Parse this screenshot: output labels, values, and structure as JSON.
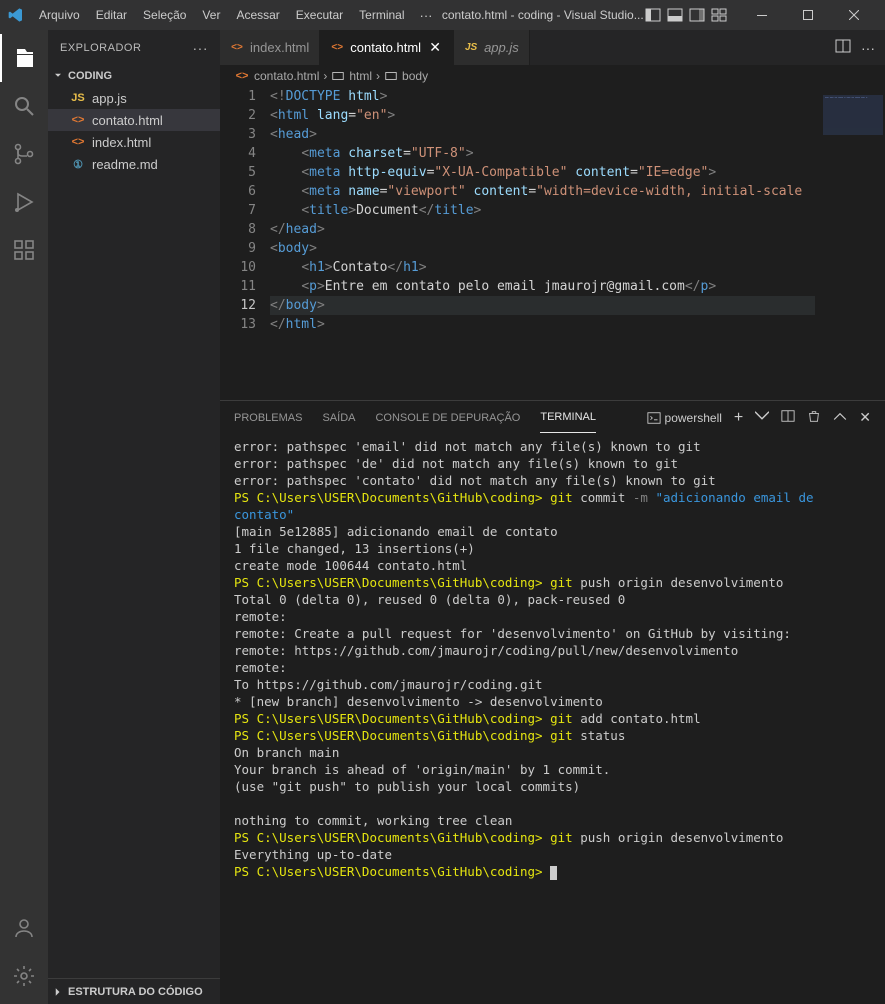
{
  "titlebar": {
    "menus": [
      "Arquivo",
      "Editar",
      "Seleção",
      "Ver",
      "Acessar",
      "Executar",
      "Terminal"
    ],
    "ellipsis": "···",
    "title": "contato.html - coding - Visual Studio..."
  },
  "sidebar": {
    "header": "EXPLORADOR",
    "folder": "CODING",
    "files": [
      {
        "name": "app.js",
        "type": "js"
      },
      {
        "name": "contato.html",
        "type": "html",
        "active": true
      },
      {
        "name": "index.html",
        "type": "html"
      },
      {
        "name": "readme.md",
        "type": "md"
      }
    ],
    "footer": "ESTRUTURA DO CÓDIGO"
  },
  "tabs": [
    {
      "name": "index.html",
      "type": "html",
      "active": false,
      "modified": false
    },
    {
      "name": "contato.html",
      "type": "html",
      "active": true,
      "modified": false,
      "close": true
    },
    {
      "name": "app.js",
      "type": "js",
      "active": false,
      "modified": true
    }
  ],
  "breadcrumb": {
    "file": "contato.html",
    "el1": "html",
    "el2": "body"
  },
  "code": {
    "lines": [
      {
        "n": 1,
        "html": "<span class='tk-bracket'>&lt;!</span><span class='tk-doct'>DOCTYPE </span><span class='tk-attr'>html</span><span class='tk-bracket'>&gt;</span>"
      },
      {
        "n": 2,
        "html": "<span class='tk-bracket'>&lt;</span><span class='tk-tag'>html</span> <span class='tk-attr'>lang</span><span class='tk-text'>=</span><span class='tk-val'>\"en\"</span><span class='tk-bracket'>&gt;</span>"
      },
      {
        "n": 3,
        "html": "<span class='tk-bracket'>&lt;</span><span class='tk-tag'>head</span><span class='tk-bracket'>&gt;</span>"
      },
      {
        "n": 4,
        "html": "    <span class='tk-bracket'>&lt;</span><span class='tk-tag'>meta</span> <span class='tk-attr'>charset</span><span class='tk-text'>=</span><span class='tk-val'>\"UTF-8\"</span><span class='tk-bracket'>&gt;</span>"
      },
      {
        "n": 5,
        "html": "    <span class='tk-bracket'>&lt;</span><span class='tk-tag'>meta</span> <span class='tk-attr'>http-equiv</span><span class='tk-text'>=</span><span class='tk-val'>\"X-UA-Compatible\"</span> <span class='tk-attr'>content</span><span class='tk-text'>=</span><span class='tk-val'>\"IE=edge\"</span><span class='tk-bracket'>&gt;</span>"
      },
      {
        "n": 6,
        "html": "    <span class='tk-bracket'>&lt;</span><span class='tk-tag'>meta</span> <span class='tk-attr'>name</span><span class='tk-text'>=</span><span class='tk-val'>\"viewport\"</span> <span class='tk-attr'>content</span><span class='tk-text'>=</span><span class='tk-val'>\"width=device-width, initial-scale</span>"
      },
      {
        "n": 7,
        "html": "    <span class='tk-bracket'>&lt;</span><span class='tk-tag'>title</span><span class='tk-bracket'>&gt;</span><span class='tk-text'>Document</span><span class='tk-bracket'>&lt;/</span><span class='tk-tag'>title</span><span class='tk-bracket'>&gt;</span>"
      },
      {
        "n": 8,
        "html": "<span class='tk-bracket'>&lt;/</span><span class='tk-tag'>head</span><span class='tk-bracket'>&gt;</span>"
      },
      {
        "n": 9,
        "html": "<span class='tk-bracket'>&lt;</span><span class='tk-tag'>body</span><span class='tk-bracket'>&gt;</span>"
      },
      {
        "n": 10,
        "html": "    <span class='tk-bracket'>&lt;</span><span class='tk-tag'>h1</span><span class='tk-bracket'>&gt;</span><span class='tk-text'>Contato</span><span class='tk-bracket'>&lt;/</span><span class='tk-tag'>h1</span><span class='tk-bracket'>&gt;</span>"
      },
      {
        "n": 11,
        "html": "    <span class='tk-bracket'>&lt;</span><span class='tk-tag'>p</span><span class='tk-bracket'>&gt;</span><span class='tk-text'>Entre em contato pelo email jmaurojr@gmail.com</span><span class='tk-bracket'>&lt;/</span><span class='tk-tag'>p</span><span class='tk-bracket'>&gt;</span>"
      },
      {
        "n": 12,
        "current": true,
        "html": "<span class='tk-bracket'>&lt;/</span><span class='tk-tag'>body</span><span class='tk-bracket'>&gt;</span>"
      },
      {
        "n": 13,
        "html": "<span class='tk-bracket'>&lt;/</span><span class='tk-tag'>html</span><span class='tk-bracket'>&gt;</span>"
      }
    ]
  },
  "panel": {
    "tabs": [
      "PROBLEMAS",
      "SAÍDA",
      "CONSOLE DE DEPURAÇÃO",
      "TERMINAL"
    ],
    "active": 3,
    "shell": "powershell"
  },
  "terminal": {
    "prompt_path": "PS C:\\Users\\USER\\Documents\\GitHub\\coding>",
    "lines": [
      "error: pathspec 'email' did not match any file(s) known to git",
      "error: pathspec 'de' did not match any file(s) known to git",
      "error: pathspec 'contato' did not match any file(s) known to git"
    ],
    "commit_msg": "\"adicionando email de contato\"",
    "commit_out": [
      "[main 5e12885] adicionando email de contato",
      " 1 file changed, 13 insertions(+)",
      " create mode 100644 contato.html"
    ],
    "push1_out": [
      "Total 0 (delta 0), reused 0 (delta 0), pack-reused 0",
      "remote:",
      "remote: Create a pull request for 'desenvolvimento' on GitHub by visiting:",
      "remote:      https://github.com/jmaurojr/coding/pull/new/desenvolvimento",
      "remote:",
      "To https://github.com/jmaurojr/coding.git",
      " * [new branch]      desenvolvimento -> desenvolvimento"
    ],
    "status_out": [
      "On branch main",
      "Your branch is ahead of 'origin/main' by 1 commit.",
      "  (use \"git push\" to publish your local commits)",
      "",
      "nothing to commit, working tree clean"
    ],
    "push2_out": [
      "Everything up-to-date"
    ]
  }
}
